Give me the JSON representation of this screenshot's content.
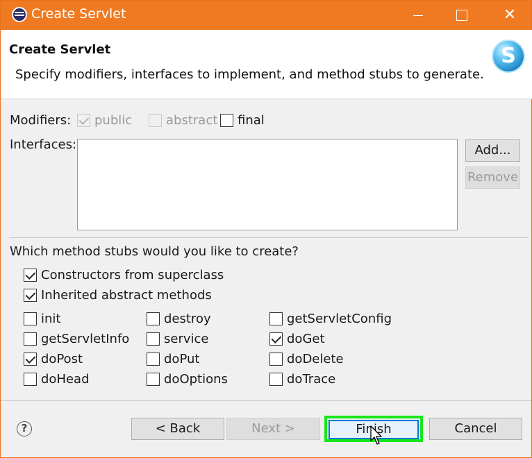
{
  "window": {
    "title": "Create Servlet"
  },
  "banner": {
    "heading": "Create Servlet",
    "description": "Specify modifiers, interfaces to implement, and method stubs to generate.",
    "logo_letter": "S"
  },
  "modifiers": {
    "label": "Modifiers:",
    "public": {
      "label": "public",
      "checked": true,
      "enabled": false
    },
    "abstract": {
      "label": "abstract",
      "checked": false,
      "enabled": false
    },
    "final": {
      "label": "final",
      "checked": false,
      "enabled": true
    }
  },
  "interfaces": {
    "label": "Interfaces:",
    "add_label": "Add...",
    "remove_label": "Remove"
  },
  "stubs": {
    "question": "Which method stubs would you like to create?",
    "constructors": {
      "label": "Constructors from superclass",
      "checked": true
    },
    "inherited": {
      "label": "Inherited abstract methods",
      "checked": true
    },
    "methods": [
      {
        "label": "init",
        "checked": false
      },
      {
        "label": "destroy",
        "checked": false
      },
      {
        "label": "getServletConfig",
        "checked": false
      },
      {
        "label": "getServletInfo",
        "checked": false
      },
      {
        "label": "service",
        "checked": false
      },
      {
        "label": "doGet",
        "checked": true
      },
      {
        "label": "doPost",
        "checked": true
      },
      {
        "label": "doPut",
        "checked": false
      },
      {
        "label": "doDelete",
        "checked": false
      },
      {
        "label": "doHead",
        "checked": false
      },
      {
        "label": "doOptions",
        "checked": false
      },
      {
        "label": "doTrace",
        "checked": false
      }
    ]
  },
  "footer": {
    "help_glyph": "?",
    "back_label": "< Back",
    "next_label": "Next >",
    "finish_label": "Finish",
    "cancel_label": "Cancel"
  },
  "colors": {
    "titlebar": "#f07a21",
    "highlight": "#19e619"
  },
  "icons": {
    "app": "eclipse-icon",
    "logo": "servlet-logo-icon",
    "help": "help-icon",
    "cursor": "mouse-pointer-icon"
  }
}
